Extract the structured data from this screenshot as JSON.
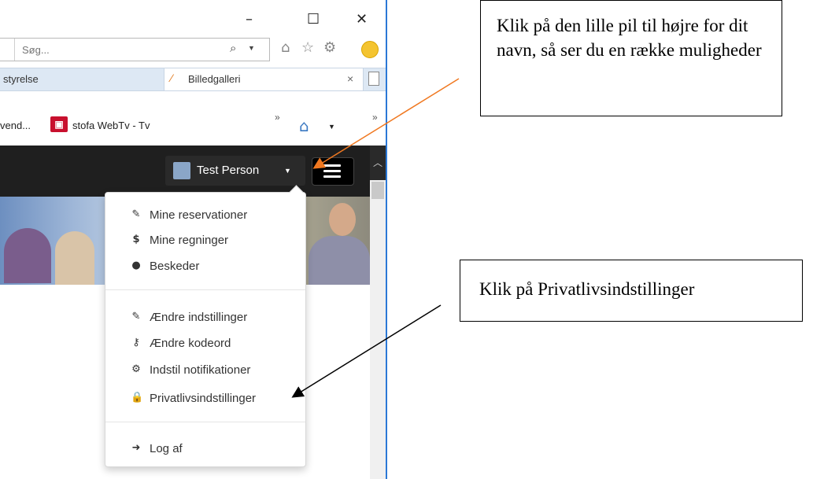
{
  "window_controls": {
    "minimize": "–",
    "maximize": "☐",
    "close": "✕"
  },
  "search": {
    "placeholder": "Søg...",
    "value": "Søg..."
  },
  "tabs": [
    {
      "label": "styrelse"
    },
    {
      "label": "Billedgalleri"
    }
  ],
  "favorites": {
    "item1": "vend...",
    "item2": "stofa WebTv - Tv"
  },
  "navbar": {
    "user_name": "Test Person"
  },
  "dropdown": {
    "items": [
      {
        "icon": "tag-icon",
        "label": "Mine reservationer"
      },
      {
        "icon": "dollar-icon",
        "label": "Mine regninger"
      },
      {
        "icon": "comments-icon",
        "label": "Beskeder"
      },
      {
        "icon": "edit-icon",
        "label": "Ændre indstillinger"
      },
      {
        "icon": "key-icon",
        "label": "Ændre kodeord"
      },
      {
        "icon": "cogs-icon",
        "label": "Indstil notifikationer"
      },
      {
        "icon": "lock-icon",
        "label": "Privatlivsindstillinger"
      },
      {
        "icon": "sign-out-icon",
        "label": "Log af"
      }
    ]
  },
  "callouts": {
    "callout1": "Klik på den lille pil til højre for dit navn, så ser du en række muligheder",
    "callout2": "Klik på Privatlivsindstillinger"
  },
  "colors": {
    "navbar": "#1f1f1f",
    "arrow1": "#f07820",
    "arrow2": "#000000",
    "window_border": "#2b78d6"
  }
}
